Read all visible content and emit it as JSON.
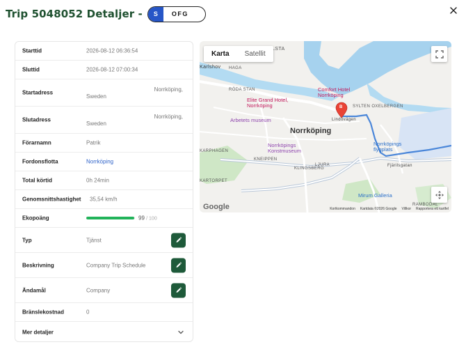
{
  "header": {
    "title": "Trip 5048052 Detaljer -",
    "plate_country": "S",
    "plate_number": "OFG"
  },
  "details": {
    "start_time_label": "Starttid",
    "start_time_value": "2026-08-12 06:36:54",
    "end_time_label": "Sluttid",
    "end_time_value": "2026-08-12 07:00:34",
    "start_address_label": "Startadress",
    "start_address_line1": "Norrköping,",
    "start_address_line2": "Sweden",
    "end_address_label": "Slutadress",
    "end_address_line1": "Norrköping,",
    "end_address_line2": "Sweden",
    "driver_label": "Förarnamn",
    "driver_value": "Patrik",
    "fleet_label": "Fordonsflotta",
    "fleet_value": "Norrköping",
    "drive_time_label": "Total körtid",
    "drive_time_value": "0h 24min",
    "avg_speed_label": "Genomsnittshastighet",
    "avg_speed_value": "35,54 km/h",
    "eco_label": "Ekopoäng",
    "eco_value": "99",
    "eco_max": "/ 100",
    "eco_fraction": 0.99,
    "type_label": "Typ",
    "type_value": "Tjänst",
    "description_label": "Beskrivning",
    "description_value": "Company Trip Schedule",
    "purpose_label": "Ändamål",
    "purpose_value": "Company",
    "fuel_cost_label": "Bränslekostnad",
    "fuel_cost_value": "0",
    "more_details_label": "Mer detaljer"
  },
  "map": {
    "tab_map": "Karta",
    "tab_satellite": "Satellit",
    "city": "Norrköping",
    "labels": {
      "lsta": "LSTA",
      "karlshov": "Karlshov",
      "haga": "HAGA",
      "roda_stan": "RÖDA STAN",
      "comfort_hotel": "Comfort Hotel\nNorrköping",
      "elite_hotel": "Elite Grand Hotel,\nNorrköping",
      "arbetets_museum": "Arbetets museum",
      "sylten": "SYLTEN  OXELBERGEN",
      "lindovagen": "Lindövägen",
      "konstmuseum": "Norrköpings\nKonstmuseum",
      "flygplats": "Norrköpings\nflygplats",
      "karphagen": "KARPHAGEN",
      "kneippen": "KNEIPPEN",
      "ljura": "LJURA",
      "klingsberg": "KLINGSBERG",
      "kartorpet": "KARTORPET",
      "fjarilsgatan": "Fjärilsgatan",
      "mirum": "Mirum Galleria",
      "ramboda": "RAMBODAL"
    },
    "marker": "B",
    "footer": {
      "shortcuts": "Kortkommandon",
      "data": "Kartdata ©2026 Google",
      "terms": "Villkor",
      "report": "Rapportera ett kartfel"
    },
    "logo": "Google"
  },
  "colors": {
    "accent": "#1e5a3a",
    "title": "#1f5130",
    "eco": "#22b35a",
    "link": "#2f63c9",
    "route": "#4a86d9"
  }
}
